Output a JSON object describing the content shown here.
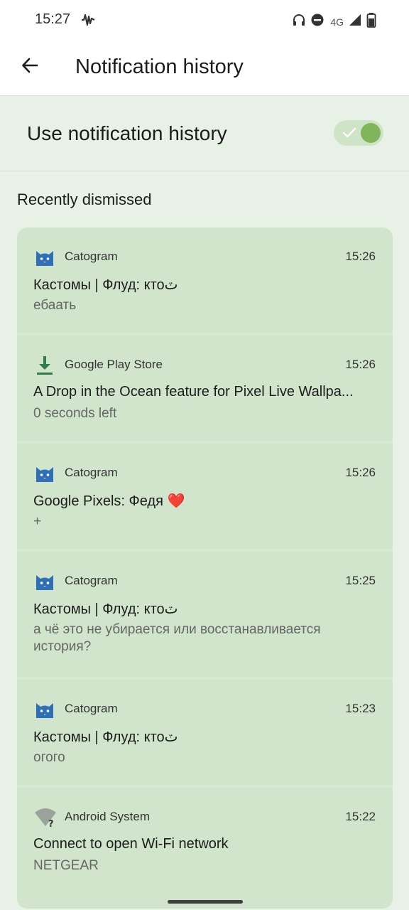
{
  "status_bar": {
    "time": "15:27",
    "network_label": "4G",
    "icons": [
      "activity-icon",
      "headphones-icon",
      "do-not-disturb-icon",
      "signal-icon",
      "battery-icon"
    ]
  },
  "app_bar": {
    "title": "Notification history",
    "back_icon": "arrow-back-icon"
  },
  "settings": {
    "use_history_label": "Use notification history",
    "use_history_enabled": true
  },
  "section": {
    "recently_dismissed": "Recently dismissed"
  },
  "notifications": [
    {
      "app": "Catogram",
      "icon": "cat-icon",
      "time": "15:26",
      "title": "Кастомы | Флуд: ктоٽ",
      "body": "ебаать"
    },
    {
      "app": "Google Play Store",
      "icon": "download-icon",
      "time": "15:26",
      "title": "A Drop in the Ocean feature for Pixel Live Wallpa...",
      "body": "0 seconds left"
    },
    {
      "app": "Catogram",
      "icon": "cat-icon",
      "time": "15:26",
      "title": "Google Pixels: Федя ❤️",
      "body": "+"
    },
    {
      "app": "Catogram",
      "icon": "cat-icon",
      "time": "15:25",
      "title": "Кастомы | Флуд: ктоٽ",
      "body": "а чё это не убирается или восстанавливается история?"
    },
    {
      "app": "Catogram",
      "icon": "cat-icon",
      "time": "15:23",
      "title": "Кастомы | Флуд: ктоٽ",
      "body": "огого"
    },
    {
      "app": "Android System",
      "icon": "wifi-question-icon",
      "time": "15:22",
      "title": "Connect to open Wi-Fi network",
      "body": "NETGEAR"
    }
  ],
  "colors": {
    "background": "#e8f1e6",
    "card": "#d0e5cb",
    "switch_on": "#7fb55b",
    "cat_icon": "#2f6fb8",
    "download_icon": "#2e7d4f"
  }
}
